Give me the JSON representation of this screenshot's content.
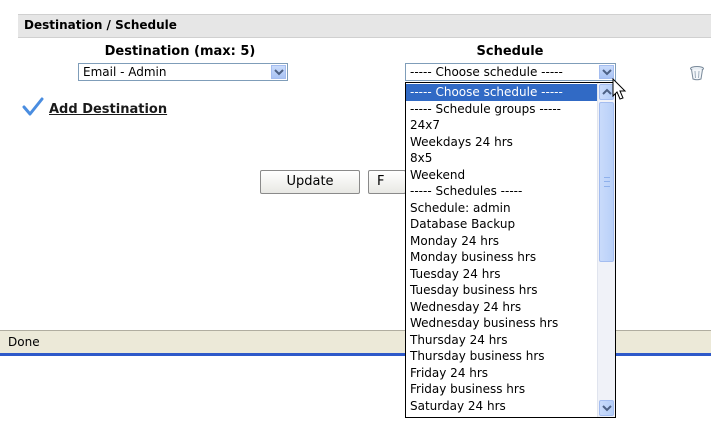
{
  "section": {
    "title": "Destination / Schedule"
  },
  "columns": {
    "destination": "Destination  (max: 5)",
    "schedule": "Schedule"
  },
  "destination_select": {
    "value": "Email - Admin"
  },
  "schedule_select": {
    "value": "----- Choose schedule -----"
  },
  "add_destination": {
    "label": "Add Destination"
  },
  "buttons": {
    "update": "Update",
    "other_partial": "F"
  },
  "status": {
    "text": "Done"
  },
  "schedule_options": [
    "----- Choose schedule -----",
    "----- Schedule groups -----",
    "24x7",
    "Weekdays 24 hrs",
    "8x5",
    "Weekend",
    "----- Schedules -----",
    "Schedule: admin",
    "Database Backup",
    "Monday 24 hrs",
    "Monday business hrs",
    "Tuesday 24 hrs",
    "Tuesday business hrs",
    "Wednesday 24 hrs",
    "Wednesday business hrs",
    "Thursday 24 hrs",
    "Thursday business hrs",
    "Friday 24 hrs",
    "Friday business hrs",
    "Saturday 24 hrs"
  ],
  "selected_option_index": 0,
  "colors": {
    "selection": "#316ac5",
    "accent_bar": "#2e59c9",
    "check": "#4a8de0"
  },
  "icons": [
    "chevron-down-icon",
    "trash-icon",
    "checkmark-icon",
    "mouse-pointer-icon",
    "chevron-up-icon"
  ]
}
